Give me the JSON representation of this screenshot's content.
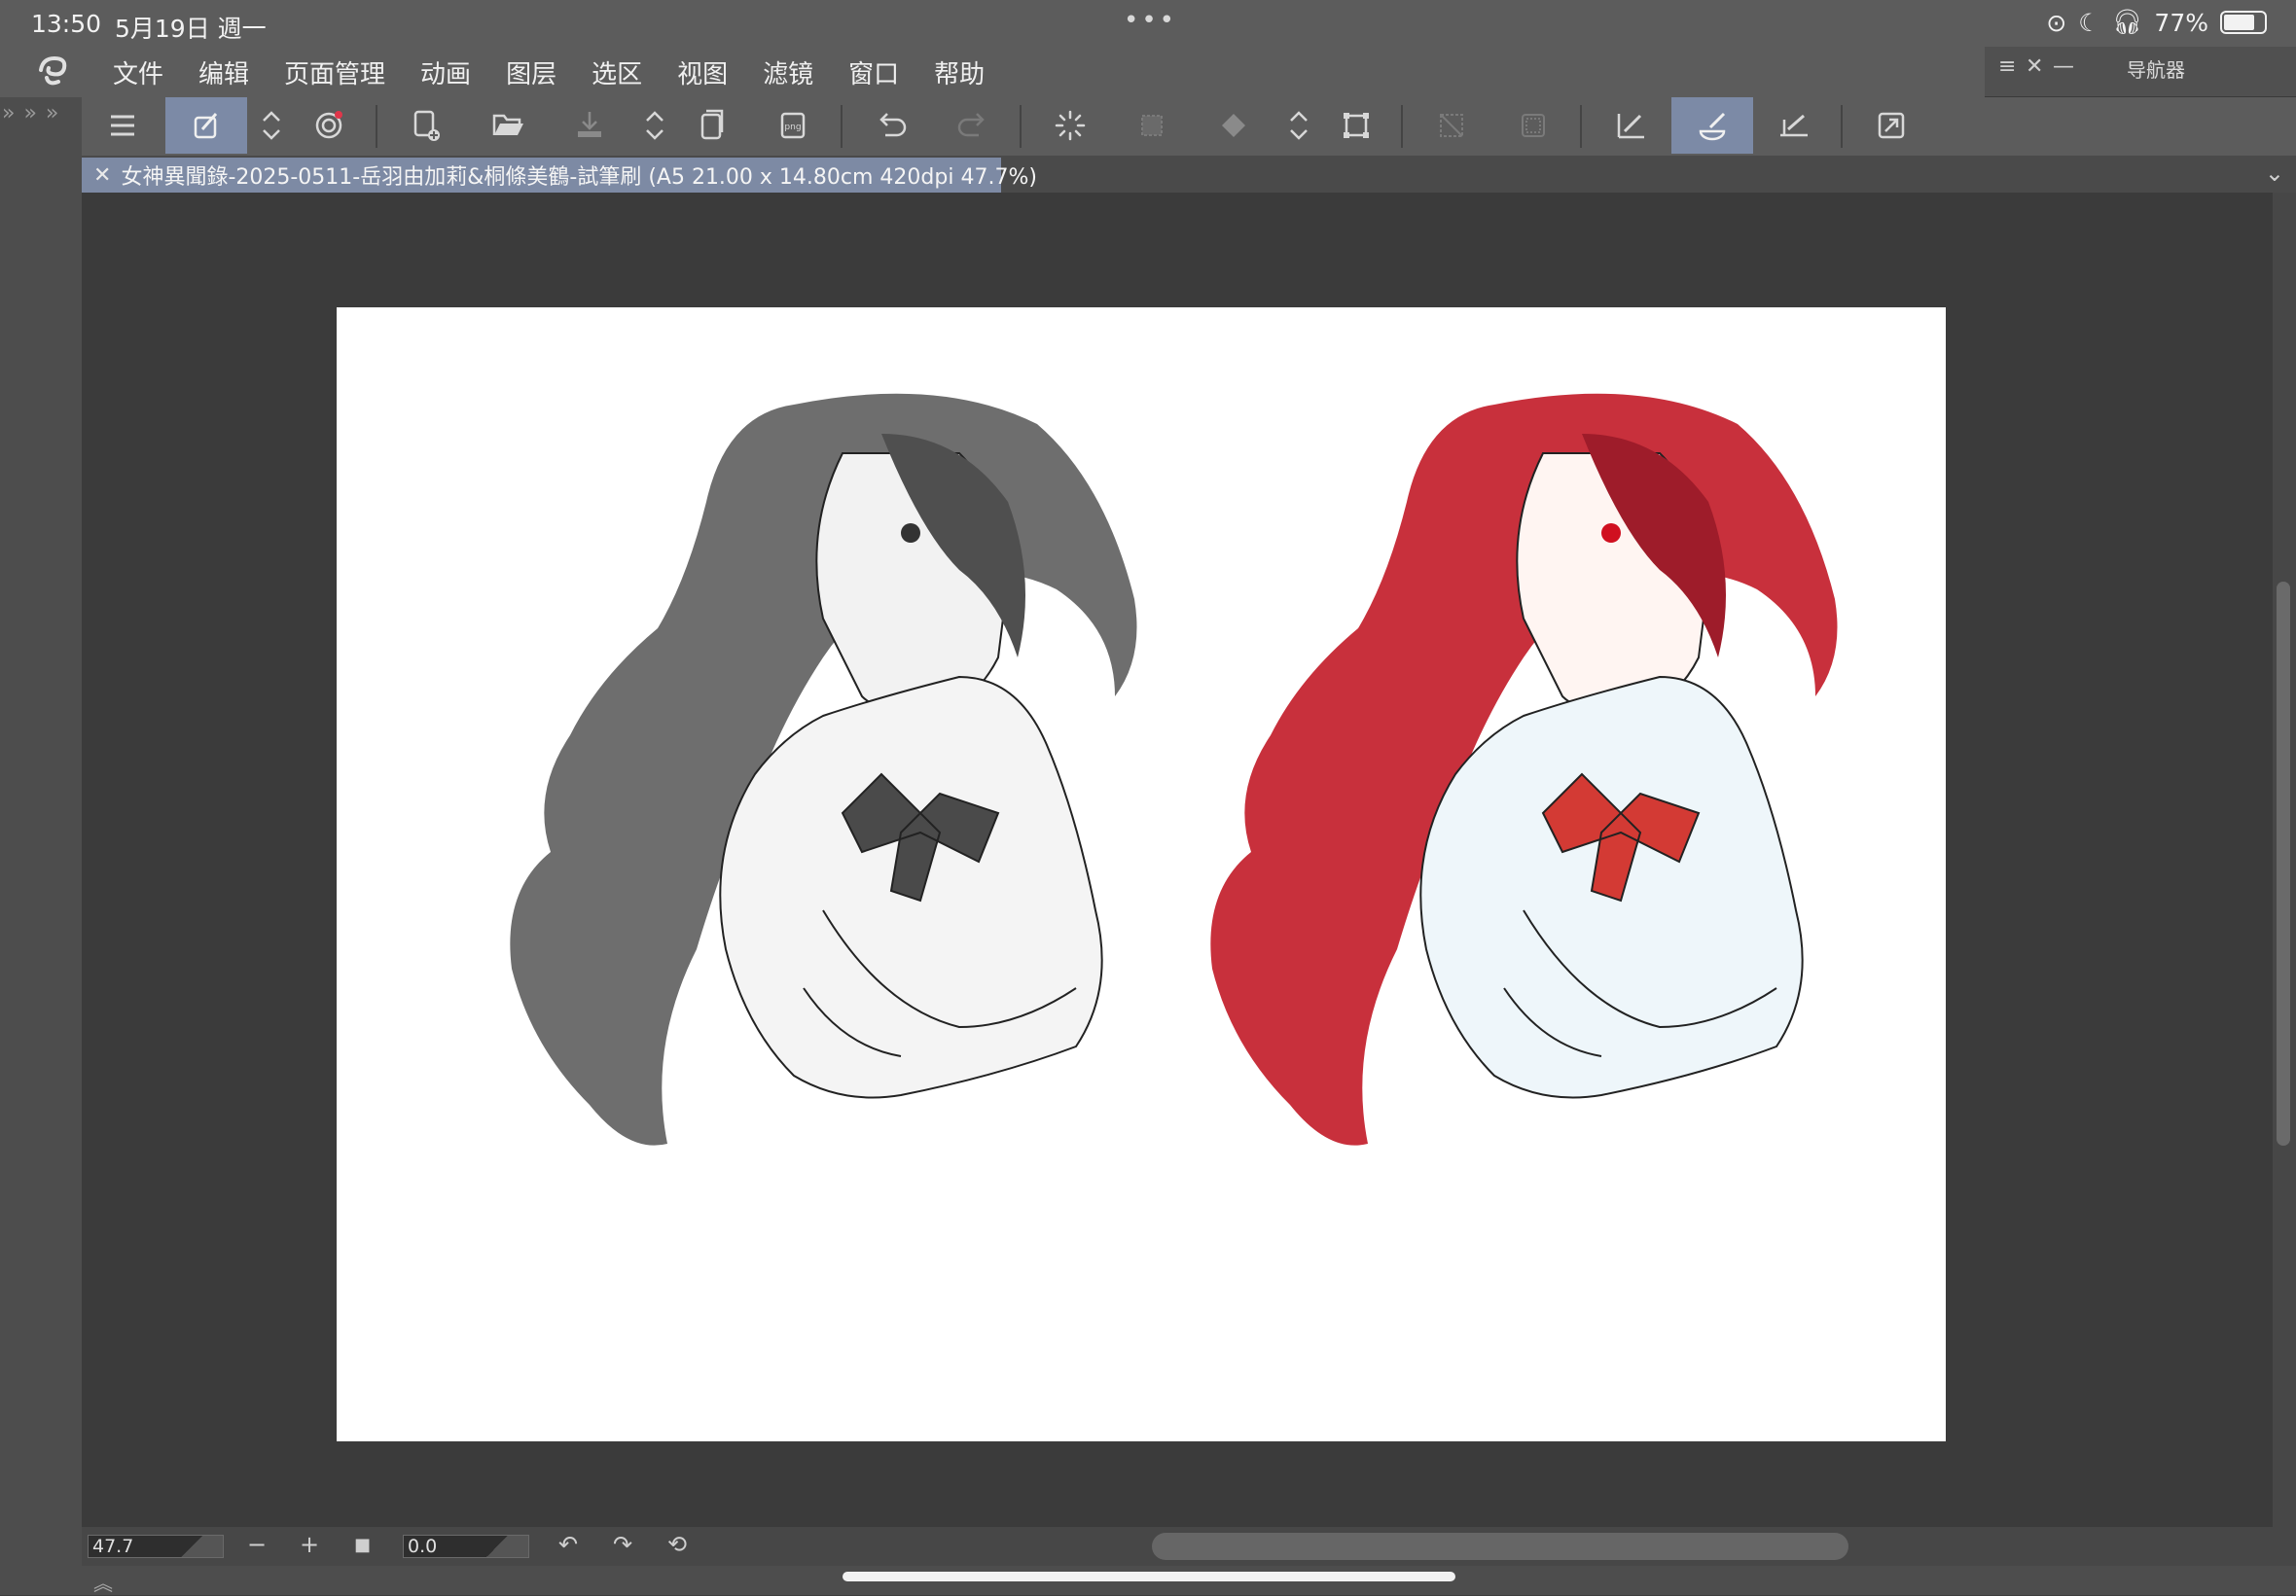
{
  "status": {
    "time": "13:50",
    "date": "5月19日 週一",
    "battery_text": "77%",
    "battery_level": 0.77,
    "dots": "•••"
  },
  "menu": {
    "items": [
      "文件",
      "编辑",
      "页面管理",
      "动画",
      "图层",
      "选区",
      "视图",
      "滤镜",
      "窗口",
      "帮助"
    ]
  },
  "navigator": {
    "title": "导航器",
    "menu_glyph": "≡",
    "close_glyph": "✕",
    "min_glyph": "—"
  },
  "left_strip": {
    "arrows": "» » »"
  },
  "document": {
    "tab_title": "女神異聞錄-2025-0511-岳羽由加莉&桐條美鶴-試筆刷 (A5 21.00 x 14.80cm 420dpi 47.7%)",
    "close_glyph": "✕",
    "chevron": "⌄"
  },
  "bottom": {
    "zoom_value": "47.7",
    "rotation_value": "0.0",
    "minus": "−",
    "plus": "+",
    "stop": "■",
    "rot_left": "↶",
    "rot_right": "↷",
    "reset": "⟲"
  },
  "footer": {
    "chevron": "︽"
  },
  "colors": {
    "chrome": "#5c5c5c",
    "active_tool": "#7c8aa6",
    "canvas_bg": "#3b3b3b",
    "hair_red": "#c8303c",
    "hair_gray": "#6e6e6e"
  },
  "toolbar_icons": [
    "hamburger-menu-icon",
    "smart-pen-icon",
    "updown-toggle-icon",
    "settings-spiral-icon",
    "new-canvas-icon",
    "open-folder-icon",
    "save-icon",
    "updown-toggle-icon",
    "export-layers-icon",
    "export-png-icon",
    "undo-icon",
    "redo-icon",
    "loading-spinner-icon",
    "select-layer-icon",
    "fill-icon",
    "updown-toggle-icon",
    "transform-icon",
    "deselect-icon",
    "select-border-icon",
    "ruler-icon",
    "brush-icon",
    "ruler-line-icon",
    "fullscreen-icon"
  ]
}
